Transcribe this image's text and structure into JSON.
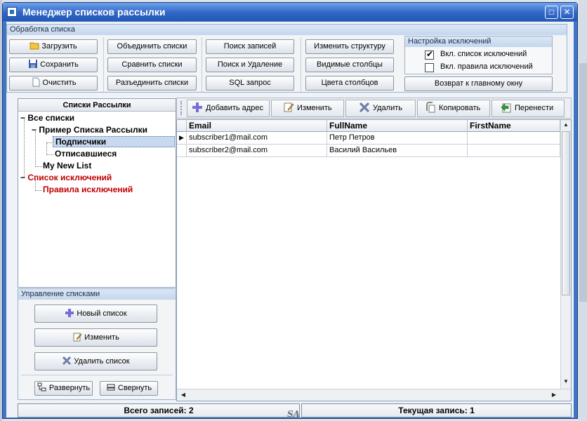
{
  "window": {
    "title": "Менеджер списков рассылки",
    "maximize_symbol": "□",
    "close_symbol": "✕"
  },
  "list_processing": {
    "label": "Обработка списка",
    "buttons": {
      "load": "Загрузить",
      "save": "Сохранить",
      "clear": "Очистить",
      "merge": "Объединить списки",
      "compare": "Сравнить списки",
      "split": "Разъединить списки",
      "search": "Поиск записей",
      "search_delete": "Поиск и Удаление",
      "sql": "SQL запрос",
      "change_structure": "Изменить структуру",
      "visible_columns": "Видимые столбцы",
      "column_colors": "Цвета столбцов"
    }
  },
  "exclusions": {
    "label": "Настройка исключений",
    "enable_list": "Вкл. список исключений",
    "enable_list_checked": true,
    "enable_rules": "Вкл. правила исключений",
    "enable_rules_checked": false,
    "back_button": "Возврат к главному окну"
  },
  "lists_panel": {
    "title": "Списки Рассылки",
    "tree": {
      "all_lists": "Все списки",
      "sample_list": "Пример Списка Рассылки",
      "subscribers": "Подписчики",
      "unsubscribed": "Отписавшиеся",
      "my_new_list": "My New List",
      "exclusion_list": "Список исключений",
      "exclusion_rules": "Правила исключений"
    }
  },
  "list_management": {
    "label": "Управление списками",
    "new_list": "Новый список",
    "edit": "Изменить",
    "delete_list": "Удалить список",
    "expand": "Развернуть",
    "collapse": "Свернуть"
  },
  "toolbar": {
    "add_address": "Добавить адрес",
    "edit": "Изменить",
    "delete": "Удалить",
    "copy": "Копировать",
    "move": "Перенести"
  },
  "grid": {
    "columns": [
      "Email",
      "FullName",
      "FirstName"
    ],
    "rows": [
      {
        "email": "subscriber1@mail.com",
        "fullname": "Петр Петров",
        "firstname": ""
      },
      {
        "email": "subscriber2@mail.com",
        "fullname": "Василий Васильев",
        "firstname": ""
      }
    ],
    "current_row_marker": "▶"
  },
  "status": {
    "total": "Всего записей: 2",
    "watermark": "SA",
    "current": "Текущая запись: 1"
  },
  "colors": {
    "title_bar": "#2f66c6",
    "accent_red": "#c00000",
    "selection": "#c8d8ee"
  }
}
